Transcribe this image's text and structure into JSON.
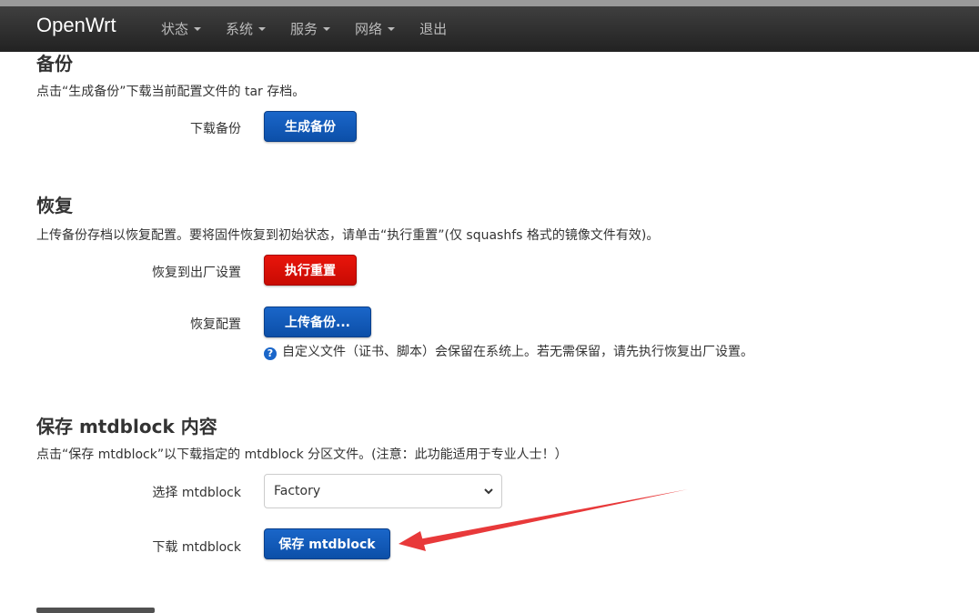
{
  "navbar": {
    "brand": "OpenWrt",
    "menu": [
      {
        "label": "状态",
        "has_dropdown": true
      },
      {
        "label": "系统",
        "has_dropdown": true
      },
      {
        "label": "服务",
        "has_dropdown": true
      },
      {
        "label": "网络",
        "has_dropdown": true
      },
      {
        "label": "退出",
        "has_dropdown": false
      }
    ]
  },
  "backup": {
    "title": "备份",
    "description": "点击“生成备份”下载当前配置文件的 tar 存档。",
    "download_label": "下载备份",
    "generate_button": "生成备份"
  },
  "restore": {
    "title": "恢复",
    "description": "上传备份存档以恢复配置。要将固件恢复到初始状态，请单击“执行重置”(仅 squashfs 格式的镜像文件有效)。",
    "factory_label": "恢复到出厂设置",
    "reset_button": "执行重置",
    "restore_label": "恢复配置",
    "upload_button": "上传备份...",
    "hint": "自定义文件（证书、脚本）会保留在系统上。若无需保留，请先执行恢复出厂设置。"
  },
  "mtdblock": {
    "title": "保存 mtdblock 内容",
    "description": "点击“保存 mtdblock”以下载指定的 mtdblock 分区文件。(注意：此功能适用于专业人士！）",
    "select_label": "选择 mtdblock",
    "select_value": "Factory",
    "download_label": "下载 mtdblock",
    "save_button": "保存 mtdblock"
  },
  "colors": {
    "navbar": "#222222",
    "primary_button": "#1a66c9",
    "danger_button": "#e8150b",
    "annotation_arrow": "#e8393a"
  }
}
